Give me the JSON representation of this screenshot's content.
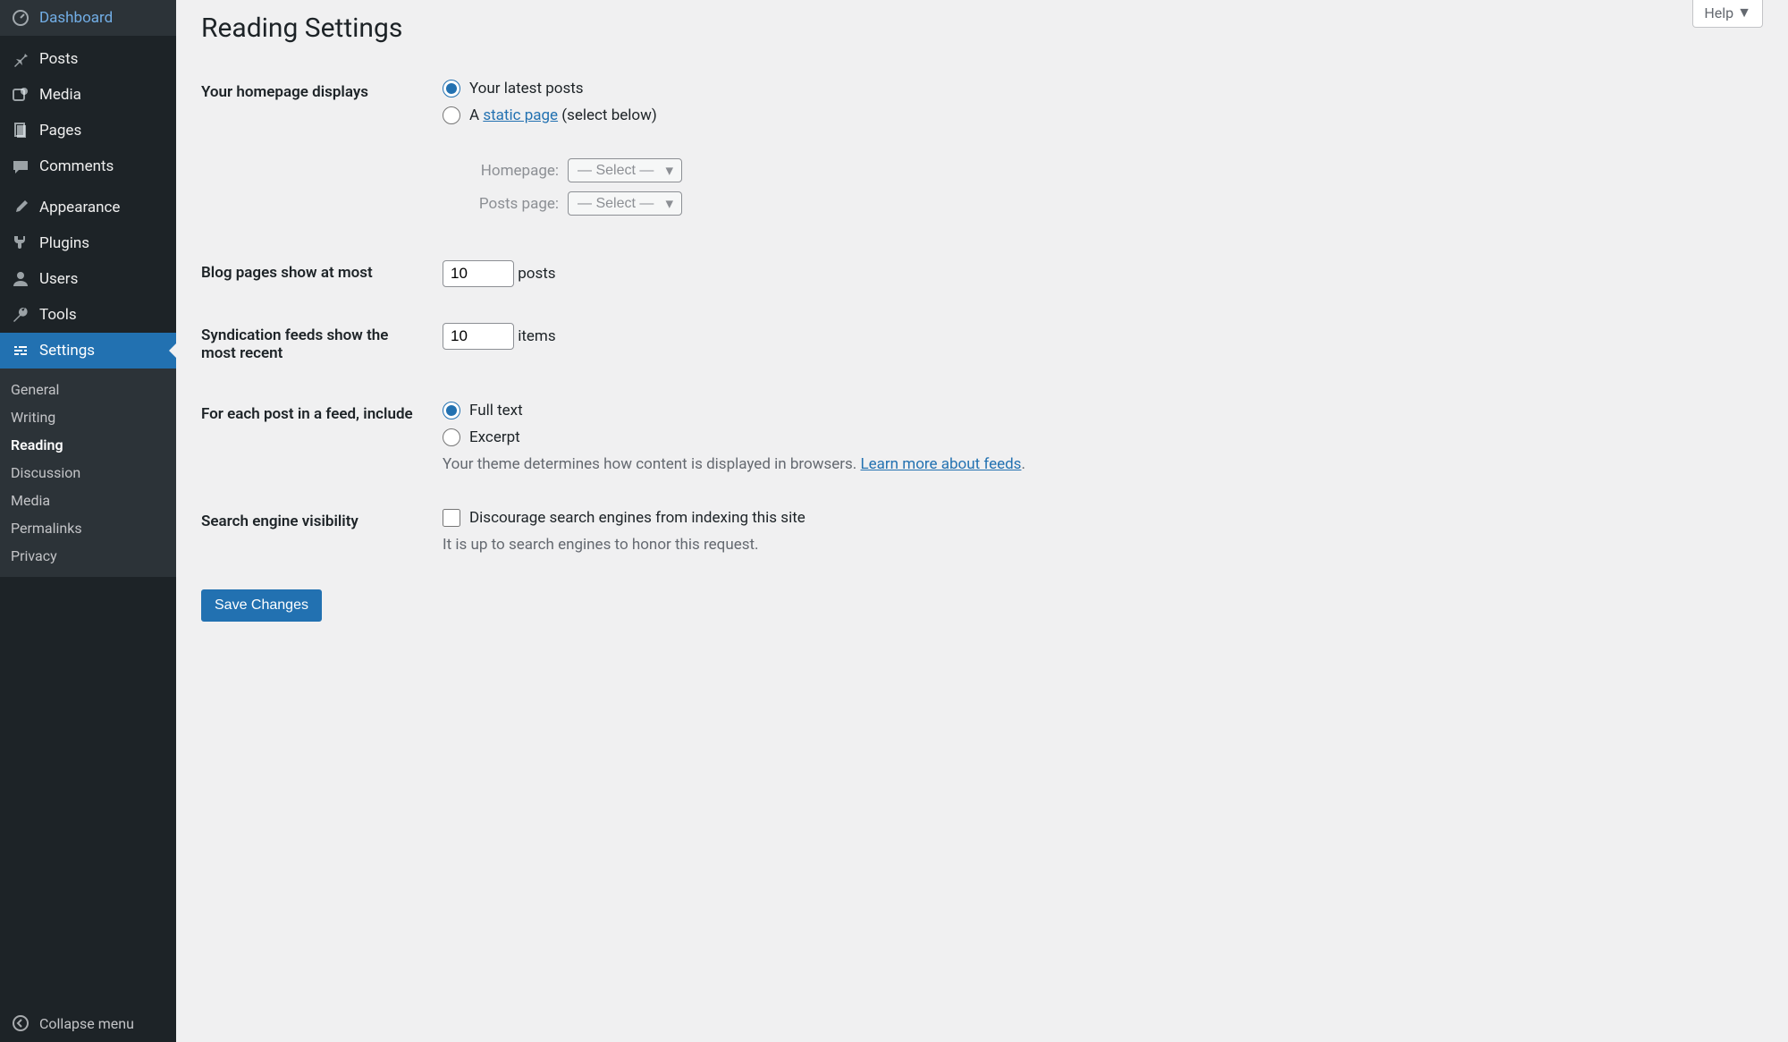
{
  "sidebar": {
    "items": [
      {
        "label": "Dashboard",
        "icon": "dashboard"
      },
      {
        "label": "Posts",
        "icon": "pin"
      },
      {
        "label": "Media",
        "icon": "media"
      },
      {
        "label": "Pages",
        "icon": "pages"
      },
      {
        "label": "Comments",
        "icon": "comment"
      },
      {
        "label": "Appearance",
        "icon": "brush"
      },
      {
        "label": "Plugins",
        "icon": "plug"
      },
      {
        "label": "Users",
        "icon": "user"
      },
      {
        "label": "Tools",
        "icon": "wrench"
      },
      {
        "label": "Settings",
        "icon": "sliders",
        "active": true
      }
    ],
    "submenu": [
      {
        "label": "General"
      },
      {
        "label": "Writing"
      },
      {
        "label": "Reading",
        "current": true
      },
      {
        "label": "Discussion"
      },
      {
        "label": "Media"
      },
      {
        "label": "Permalinks"
      },
      {
        "label": "Privacy"
      }
    ],
    "collapse": "Collapse menu"
  },
  "help_label": "Help",
  "page_title": "Reading Settings",
  "rows": {
    "homepage_displays": {
      "label": "Your homepage displays",
      "opt_latest": "Your latest posts",
      "opt_static_prefix": "A ",
      "opt_static_link": "static page",
      "opt_static_suffix": " (select below)",
      "homepage_label": "Homepage:",
      "postspage_label": "Posts page:",
      "select_placeholder": "— Select —"
    },
    "blog_pages": {
      "label": "Blog pages show at most",
      "value": 10,
      "suffix": "posts"
    },
    "syndication": {
      "label": "Syndication feeds show the most recent",
      "value": 10,
      "suffix": "items"
    },
    "feed_include": {
      "label": "For each post in a feed, include",
      "opt_full": "Full text",
      "opt_excerpt": "Excerpt",
      "desc_prefix": "Your theme determines how content is displayed in browsers. ",
      "desc_link": "Learn more about feeds",
      "desc_suffix": "."
    },
    "search_visibility": {
      "label": "Search engine visibility",
      "checkbox": "Discourage search engines from indexing this site",
      "desc": "It is up to search engines to honor this request."
    }
  },
  "submit_label": "Save Changes"
}
